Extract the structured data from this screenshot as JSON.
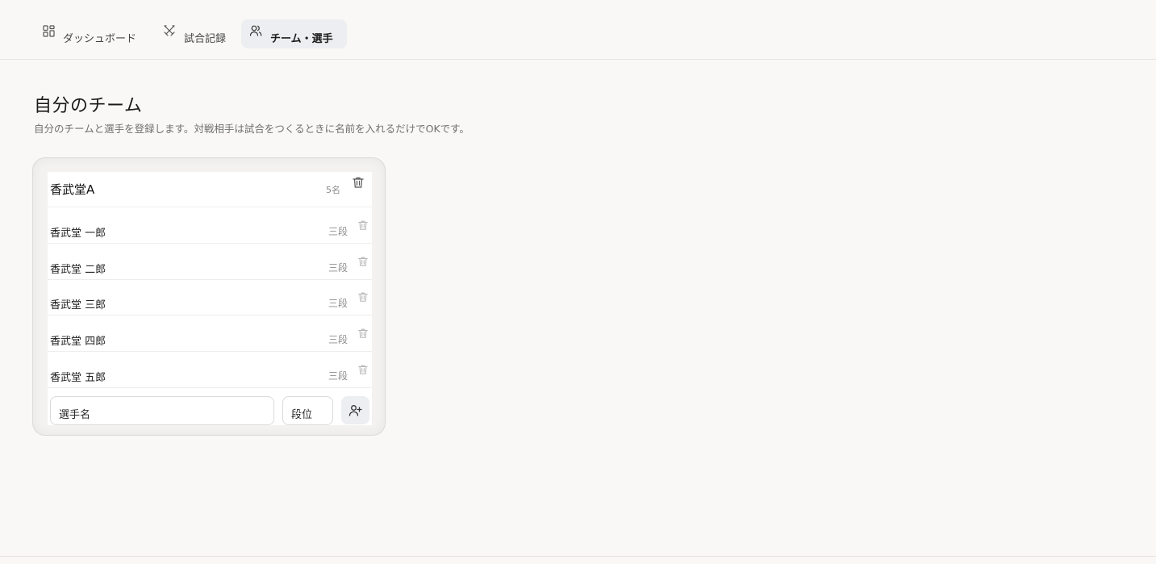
{
  "nav": {
    "items": [
      {
        "label": "ダッシュボード",
        "icon": "dashboard-grid-icon"
      },
      {
        "label": "試合記録",
        "icon": "crossed-swords-icon"
      },
      {
        "label": "チーム・選手",
        "icon": "users-icon",
        "active": true
      }
    ]
  },
  "page": {
    "title": "自分のチーム",
    "subtitle": "自分のチームと選手を登録します。対戦相手は試合をつくるときに名前を入れるだけでOKです。"
  },
  "team": {
    "name": "香武堂A",
    "count": "5名",
    "players": [
      {
        "name": "香武堂 一郎",
        "rank": "三段"
      },
      {
        "name": "香武堂 二郎",
        "rank": "三段"
      },
      {
        "name": "香武堂 三郎",
        "rank": "三段"
      },
      {
        "name": "香武堂 四郎",
        "rank": "三段"
      },
      {
        "name": "香武堂 五郎",
        "rank": "三段"
      }
    ],
    "form": {
      "name_placeholder": "選手名",
      "rank_placeholder": "段位",
      "add_icon": "add-user-icon"
    }
  },
  "colors": {
    "background": "#f9f8f6",
    "active_tab": "#edeef1",
    "muted_text": "#8c8c8c"
  }
}
